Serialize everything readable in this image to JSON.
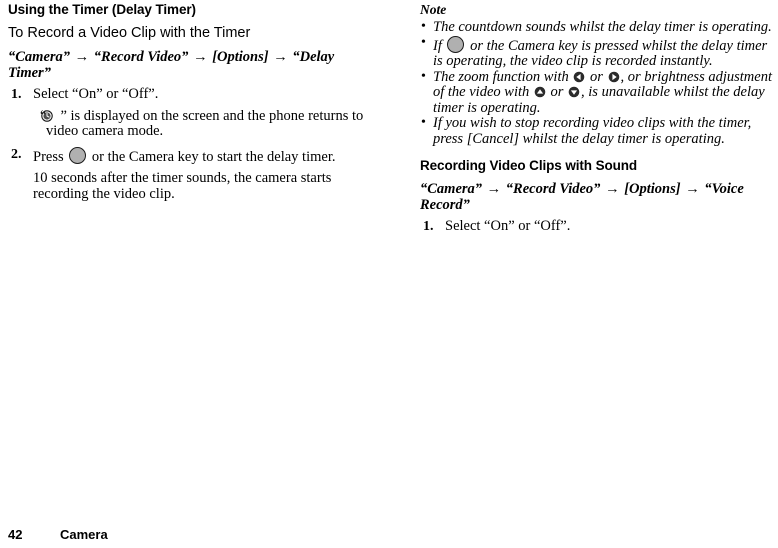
{
  "document": {
    "left_column": {
      "section_heading": "Using the Timer (Delay Timer)",
      "sub_heading": "To Record a Video Clip with the Timer",
      "breadcrumb": {
        "parts": [
          "“Camera”",
          "“Record Video”",
          "[Options]",
          "“Delay Timer”"
        ],
        "separator": "→"
      },
      "steps": [
        {
          "number": "1.",
          "text": "Select “On” or “Off”.",
          "note_prefix": "“",
          "note_icon": "timer-icon",
          "note_suffix": "” is displayed on the screen and the phone returns to video camera mode."
        },
        {
          "number": "2.",
          "text_before_icon": "Press",
          "icon": "center-key-icon",
          "text_after_icon": "or the Camera key to start the delay timer.",
          "note": "10 seconds after the timer sounds, the camera starts recording the video clip."
        }
      ]
    },
    "right_column": {
      "note_heading": "Note",
      "notes": [
        {
          "text": "The countdown sounds whilst the delay timer is operating."
        },
        {
          "text_before_icon": "If",
          "icon": "center-key-icon",
          "text_after_icon": "or the Camera key is pressed whilst the delay timer is operating, the video clip is recorded instantly."
        },
        {
          "part1": "The zoom function with",
          "icon1": "dpad-left-icon",
          "part2": "or",
          "icon2": "dpad-right-icon",
          "part3": ", or brightness adjustment of the video with",
          "icon3": "dpad-up-icon",
          "part4": "or",
          "icon4": "dpad-down-icon",
          "part5": ", is unavailable whilst the delay timer is operating."
        },
        {
          "text": "If you wish to stop recording video clips with the timer, press [Cancel] whilst the delay timer is operating."
        }
      ],
      "section_heading": "Recording Video Clips with Sound",
      "breadcrumb": {
        "parts": [
          "“Camera”",
          "“Record Video”",
          "[Options]",
          "“Voice Record”"
        ],
        "separator": "→"
      },
      "steps": [
        {
          "number": "1.",
          "text": "Select “On” or “Off”."
        }
      ]
    },
    "footer": {
      "page_number": "42",
      "chapter": "Camera"
    }
  }
}
